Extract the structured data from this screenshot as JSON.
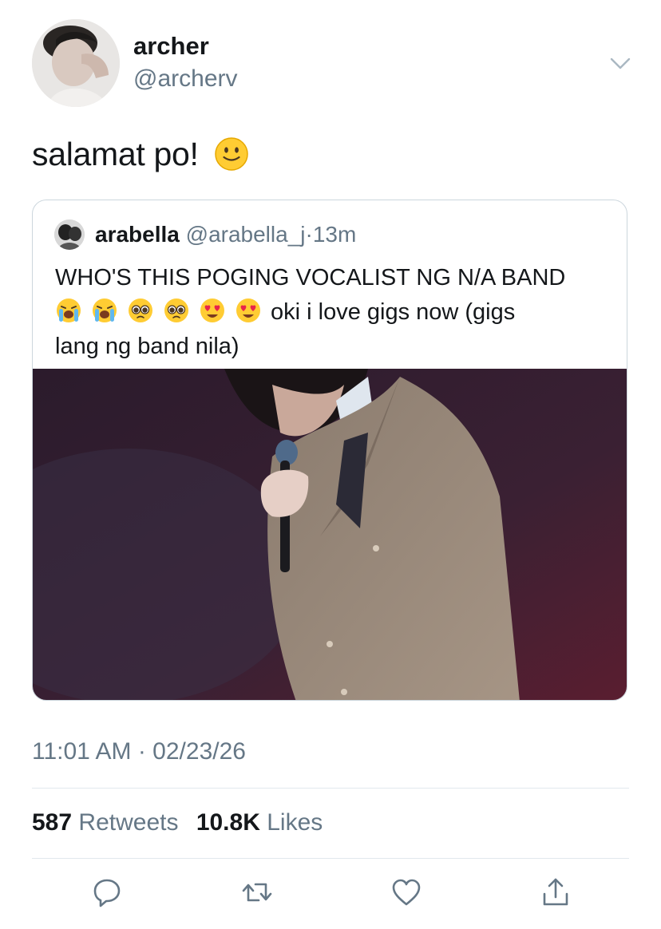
{
  "tweet": {
    "author_name": "archer",
    "author_handle": "@archerv",
    "text": "salamat po!",
    "emoji": "slightly-smiling-face",
    "timestamp": "11:01 AM · 02/23/26",
    "retweets_count": "587",
    "retweets_label": "Retweets",
    "likes_count": "10.8K",
    "likes_label": "Likes"
  },
  "quoted": {
    "author_name": "arabella",
    "author_handle": "@arabella_j",
    "separator": "·",
    "time": "13m",
    "line1": "WHO'S THIS POGING VOCALIST NG N/A BAND",
    "emojis": [
      "loudly-crying-face",
      "loudly-crying-face",
      "pleading-face",
      "pleading-face",
      "heart-eyes-face",
      "heart-eyes-face"
    ],
    "line2_tail": "oki i love gigs now (gigs",
    "line3": "lang ng band nila)"
  },
  "actions": [
    "reply-icon",
    "retweet-icon",
    "like-icon",
    "share-icon"
  ],
  "colors": {
    "text": "#14171a",
    "secondary": "#657786",
    "border": "#ccd6dd"
  }
}
